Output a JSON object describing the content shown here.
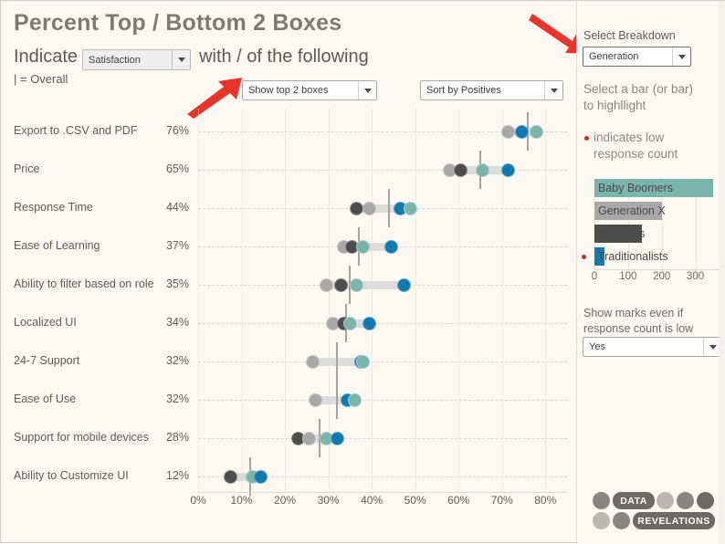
{
  "header": {
    "title": "Percent Top / Bottom 2 Boxes",
    "indicate_label": "Indicate",
    "satisfaction_value": "Satisfaction",
    "with_label": "with / of the following",
    "overall_note": "| = Overall"
  },
  "controls": {
    "top_boxes_value": "Show top 2 boxes",
    "sort_value": "Sort by Positives",
    "breakdown_label": "Select Breakdown",
    "breakdown_value": "Generation",
    "highlight_text_line1": "Select a bar (or bar)",
    "highlight_text_line2": "to highllight",
    "low_count_line1": "indicates low",
    "low_count_line2": "response count",
    "show_marks_line1": "Show marks even if",
    "show_marks_line2": "response count is low",
    "show_marks_value": "Yes"
  },
  "colors": {
    "baby_boomers": "#79b5ab",
    "generation_x": "#a8a8a8",
    "millenials": "#4d4d4d",
    "traditionalists": "#1279ae",
    "connector": "#dcdcdc",
    "overall_mark": "#a8a49c",
    "background": "#fdf9f2",
    "low_count_dot": "#d62728",
    "arrow": "#e8342a"
  },
  "legend_chart": {
    "type": "bar",
    "title": "",
    "xlabel": "",
    "ylabel": "",
    "categories": [
      "Baby Boomers",
      "Generation X",
      "Millenials",
      "Traditionalists"
    ],
    "values": [
      352,
      200,
      140,
      30
    ],
    "colors": [
      "#79b5ab",
      "#a8a8a8",
      "#4d4d4d",
      "#1279ae"
    ],
    "low_count_flags": [
      false,
      false,
      false,
      true
    ],
    "xticks": [
      0,
      100,
      200,
      300
    ],
    "xlim": [
      0,
      380
    ],
    "grid": true,
    "legend_position": "none"
  },
  "chart_data": {
    "type": "scatter",
    "title": "Percent Top / Bottom 2 Boxes",
    "xlabel": "",
    "ylabel": "",
    "xlim": [
      0,
      85
    ],
    "xticks": [
      0,
      10,
      20,
      30,
      40,
      50,
      60,
      70,
      80
    ],
    "xtick_labels": [
      "0%",
      "10%",
      "20%",
      "30%",
      "40%",
      "50%",
      "60%",
      "70%",
      "80%"
    ],
    "grid": true,
    "legend_position": "right-panel",
    "series_names": [
      "Baby Boomers",
      "Generation X",
      "Millenials",
      "Traditionalists"
    ],
    "categories": [
      "Export to .CSV and PDF",
      "Price",
      "Response Time",
      "Ease of Learning",
      "Ability to filter based on role",
      "Localized UI",
      "24-7 Support",
      "Ease of Use",
      "Support for mobile devices",
      "Ability to Customize UI"
    ],
    "overall_values": [
      76,
      65,
      44,
      37,
      35,
      34,
      32,
      32,
      28,
      12
    ],
    "overall_labels": [
      "76%",
      "65%",
      "44%",
      "37%",
      "35%",
      "34%",
      "32%",
      "32%",
      "28%",
      "12%"
    ],
    "rows": [
      {
        "category": "Export to .CSV and PDF",
        "overall": 76,
        "overall_label": "76%",
        "points": [
          {
            "series": "Generation X",
            "value": 71.5,
            "color": "#a8a8a8"
          },
          {
            "series": "Traditionalists",
            "value": 74.5,
            "color": "#1279ae"
          },
          {
            "series": "Baby Boomers",
            "value": 78.0,
            "color": "#79b5ab"
          }
        ]
      },
      {
        "category": "Price",
        "overall": 65,
        "overall_label": "65%",
        "points": [
          {
            "series": "Generation X",
            "value": 58.0,
            "color": "#a8a8a8"
          },
          {
            "series": "Millenials",
            "value": 60.5,
            "color": "#4d4d4d"
          },
          {
            "series": "Baby Boomers",
            "value": 65.5,
            "color": "#79b5ab"
          },
          {
            "series": "Traditionalists",
            "value": 71.5,
            "color": "#1279ae"
          }
        ]
      },
      {
        "category": "Response Time",
        "overall": 44,
        "overall_label": "44%",
        "points": [
          {
            "series": "Millenials",
            "value": 36.5,
            "color": "#4d4d4d"
          },
          {
            "series": "Generation X",
            "value": 39.5,
            "color": "#a8a8a8"
          },
          {
            "series": "Traditionalists",
            "value": 46.5,
            "color": "#1279ae"
          },
          {
            "series": "Baby Boomers",
            "value": 49.0,
            "color": "#79b5ab"
          }
        ]
      },
      {
        "category": "Ease of Learning",
        "overall": 37,
        "overall_label": "37%",
        "points": [
          {
            "series": "Generation X",
            "value": 33.5,
            "color": "#a8a8a8"
          },
          {
            "series": "Millenials",
            "value": 35.5,
            "color": "#4d4d4d"
          },
          {
            "series": "Baby Boomers",
            "value": 38.0,
            "color": "#79b5ab"
          },
          {
            "series": "Traditionalists",
            "value": 44.5,
            "color": "#1279ae"
          }
        ]
      },
      {
        "category": "Ability to filter based on role",
        "overall": 35,
        "overall_label": "35%",
        "points": [
          {
            "series": "Generation X",
            "value": 29.5,
            "color": "#a8a8a8"
          },
          {
            "series": "Millenials",
            "value": 33.0,
            "color": "#4d4d4d"
          },
          {
            "series": "Baby Boomers",
            "value": 36.5,
            "color": "#79b5ab"
          },
          {
            "series": "Traditionalists",
            "value": 47.5,
            "color": "#1279ae"
          }
        ]
      },
      {
        "category": "Localized UI",
        "overall": 34,
        "overall_label": "34%",
        "points": [
          {
            "series": "Generation X",
            "value": 31.0,
            "color": "#a8a8a8"
          },
          {
            "series": "Millenials",
            "value": 33.5,
            "color": "#4d4d4d"
          },
          {
            "series": "Baby Boomers",
            "value": 35.0,
            "color": "#79b5ab"
          },
          {
            "series": "Traditionalists",
            "value": 39.5,
            "color": "#1279ae"
          }
        ]
      },
      {
        "category": "24-7 Support",
        "overall": 32,
        "overall_label": "32%",
        "points": [
          {
            "series": "Generation X",
            "value": 26.5,
            "color": "#a8a8a8"
          },
          {
            "series": "Traditionalists",
            "value": 37.5,
            "color": "#1279ae"
          },
          {
            "series": "Baby Boomers",
            "value": 38.0,
            "color": "#79b5ab"
          }
        ]
      },
      {
        "category": "Ease of Use",
        "overall": 32,
        "overall_label": "32%",
        "points": [
          {
            "series": "Generation X",
            "value": 27.0,
            "color": "#a8a8a8"
          },
          {
            "series": "Traditionalists",
            "value": 34.5,
            "color": "#1279ae"
          },
          {
            "series": "Baby Boomers",
            "value": 36.0,
            "color": "#79b5ab"
          }
        ]
      },
      {
        "category": "Support for mobile devices",
        "overall": 28,
        "overall_label": "28%",
        "points": [
          {
            "series": "Millenials",
            "value": 23.0,
            "color": "#4d4d4d"
          },
          {
            "series": "Generation X",
            "value": 25.5,
            "color": "#a8a8a8"
          },
          {
            "series": "Baby Boomers",
            "value": 29.5,
            "color": "#79b5ab"
          },
          {
            "series": "Traditionalists",
            "value": 32.0,
            "color": "#1279ae"
          }
        ]
      },
      {
        "category": "Ability to Customize UI",
        "overall": 12,
        "overall_label": "12%",
        "points": [
          {
            "series": "Millenials",
            "value": 7.5,
            "color": "#4d4d4d"
          },
          {
            "series": "Baby Boomers",
            "value": 12.5,
            "color": "#79b5ab"
          },
          {
            "series": "Traditionalists",
            "value": 14.5,
            "color": "#1279ae"
          }
        ]
      }
    ]
  },
  "logo": {
    "line1": "DATA",
    "line2": "REVELATIONS"
  }
}
